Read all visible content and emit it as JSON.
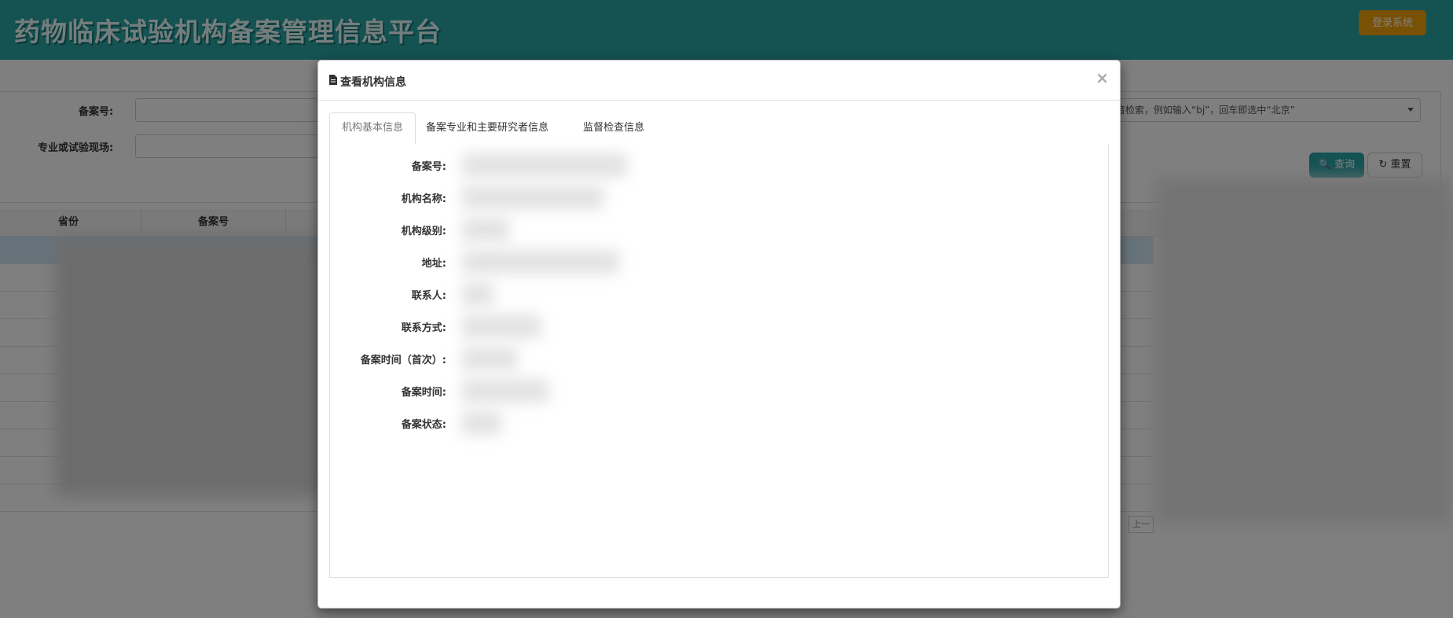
{
  "header": {
    "title": "药物临床试验机构备案管理信息平台",
    "login_label": "登录系统"
  },
  "search": {
    "record_no_label": "备案号:",
    "specialty_label": "专业或试验现场:",
    "province_hint": "音检索，例如输入“bj”，回车即选中“北京”",
    "query_label": "查询",
    "reset_label": "重置"
  },
  "table": {
    "headers": [
      "省份",
      "备案号"
    ],
    "pager_prev": "上一"
  },
  "modal": {
    "title": "查看机构信息",
    "close": "×",
    "tabs": [
      {
        "label": "机构基本信息",
        "active": true
      },
      {
        "label": "备案专业和主要研究者信息",
        "active": false
      },
      {
        "label": "监督检查信息",
        "active": false
      }
    ],
    "fields": [
      {
        "label": "备案号:"
      },
      {
        "label": "机构名称:"
      },
      {
        "label": "机构级别:"
      },
      {
        "label": "地址:"
      },
      {
        "label": "联系人:"
      },
      {
        "label": "联系方式:"
      },
      {
        "label": "备案时间（首次）:"
      },
      {
        "label": "备案时间:"
      },
      {
        "label": "备案状态:"
      }
    ]
  },
  "colors": {
    "header_bg": "#2aa4a4",
    "login_bg": "#f0a30a",
    "query_bg": "#2aa4a4"
  }
}
